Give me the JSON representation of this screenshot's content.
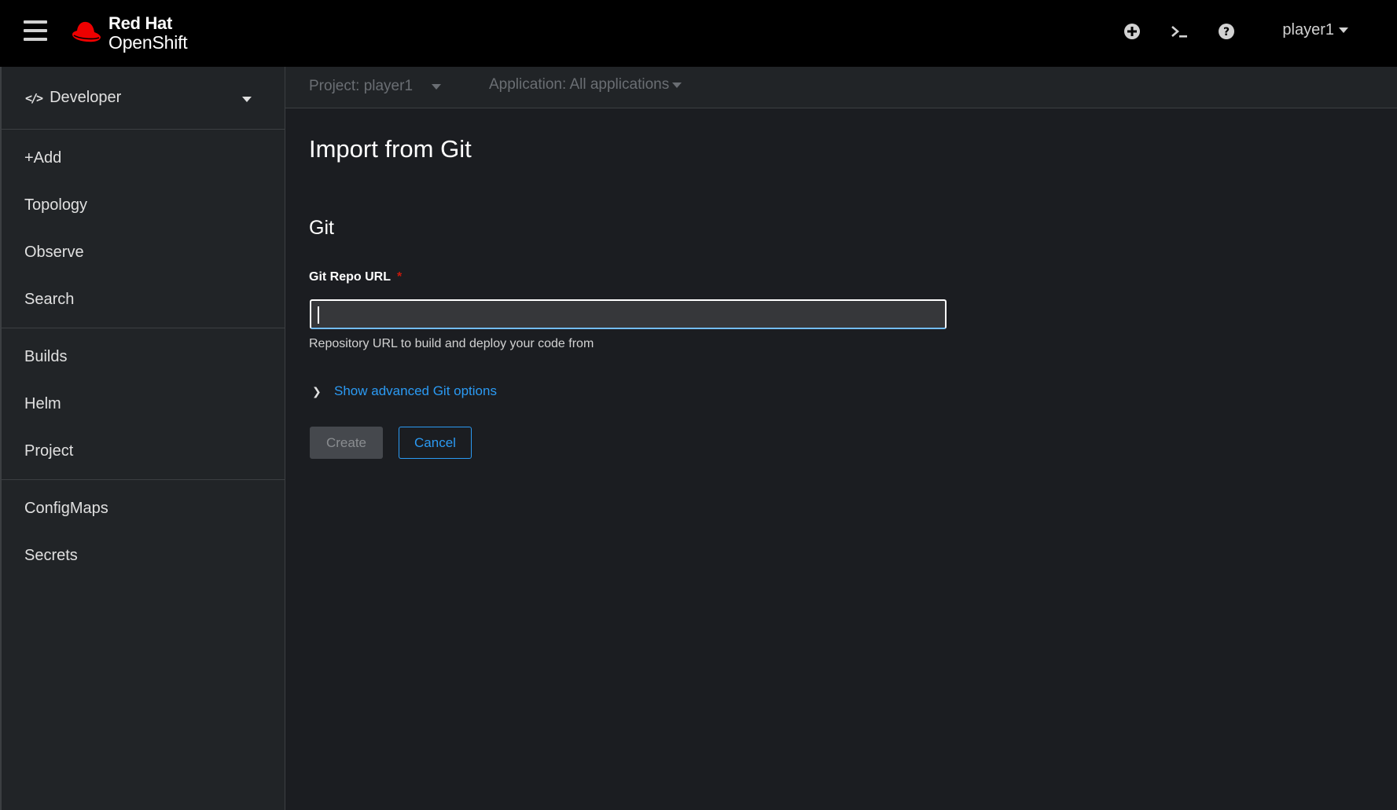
{
  "masthead": {
    "brand_line1": "Red Hat",
    "brand_line2": "OpenShift",
    "user_label": "player1",
    "icons": [
      "hamburger-icon",
      "redhat-fedora-icon",
      "add-circle-icon",
      "terminal-icon",
      "help-icon"
    ]
  },
  "sidebar": {
    "perspective_label": "Developer",
    "groups": [
      [
        {
          "label": "+Add"
        },
        {
          "label": "Topology"
        },
        {
          "label": "Observe"
        },
        {
          "label": "Search"
        }
      ],
      [
        {
          "label": "Builds"
        },
        {
          "label": "Helm"
        },
        {
          "label": "Project"
        }
      ],
      [
        {
          "label": "ConfigMaps"
        },
        {
          "label": "Secrets"
        }
      ]
    ]
  },
  "context": {
    "project_label": "Project: player1",
    "application_label": "Application: All applications"
  },
  "main": {
    "title": "Import from Git",
    "section_title": "Git",
    "field_label": "Git Repo URL",
    "field_required_marker": "*",
    "field_value": "",
    "helper_text": "Repository URL to build and deploy your code from",
    "advanced_link": "Show advanced Git options",
    "create_label": "Create",
    "cancel_label": "Cancel"
  },
  "colors": {
    "accent": "#2b9af3",
    "required": "#c9190b",
    "brand_red": "#ee0000"
  }
}
